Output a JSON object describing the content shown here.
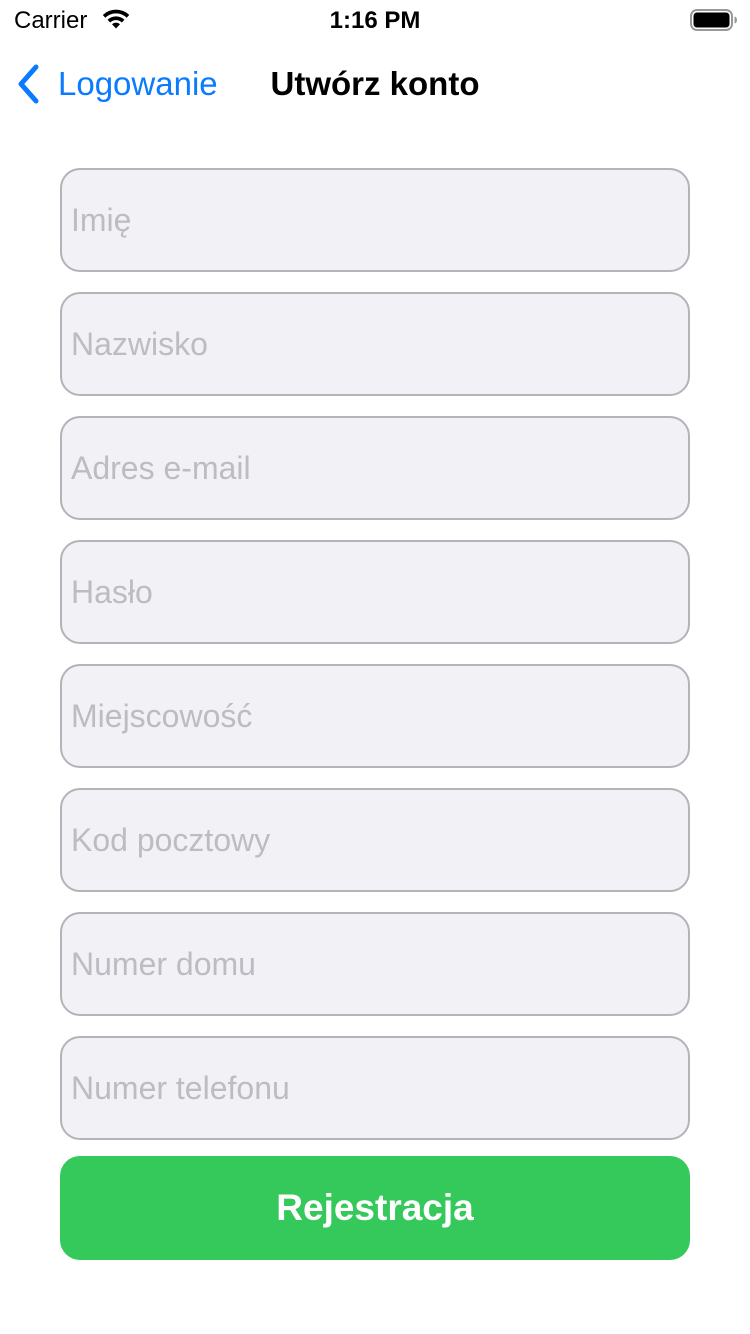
{
  "status_bar": {
    "carrier": "Carrier",
    "time": "1:16 PM"
  },
  "nav": {
    "back_label": "Logowanie",
    "title": "Utwórz konto"
  },
  "form": {
    "fields": [
      {
        "placeholder": "Imię",
        "value": ""
      },
      {
        "placeholder": "Nazwisko",
        "value": ""
      },
      {
        "placeholder": "Adres e-mail",
        "value": ""
      },
      {
        "placeholder": "Hasło",
        "value": ""
      },
      {
        "placeholder": "Miejscowość",
        "value": ""
      },
      {
        "placeholder": "Kod pocztowy",
        "value": ""
      },
      {
        "placeholder": "Numer domu",
        "value": ""
      },
      {
        "placeholder": "Numer telefonu",
        "value": ""
      }
    ],
    "submit_label": "Rejestracja"
  },
  "colors": {
    "accent": "#0a7aff",
    "submit": "#35c85a",
    "field_bg": "#f1f1f6",
    "field_border": "#b4b4b8"
  },
  "icons": [
    "wifi-icon",
    "battery-icon",
    "chevron-left-icon"
  ]
}
